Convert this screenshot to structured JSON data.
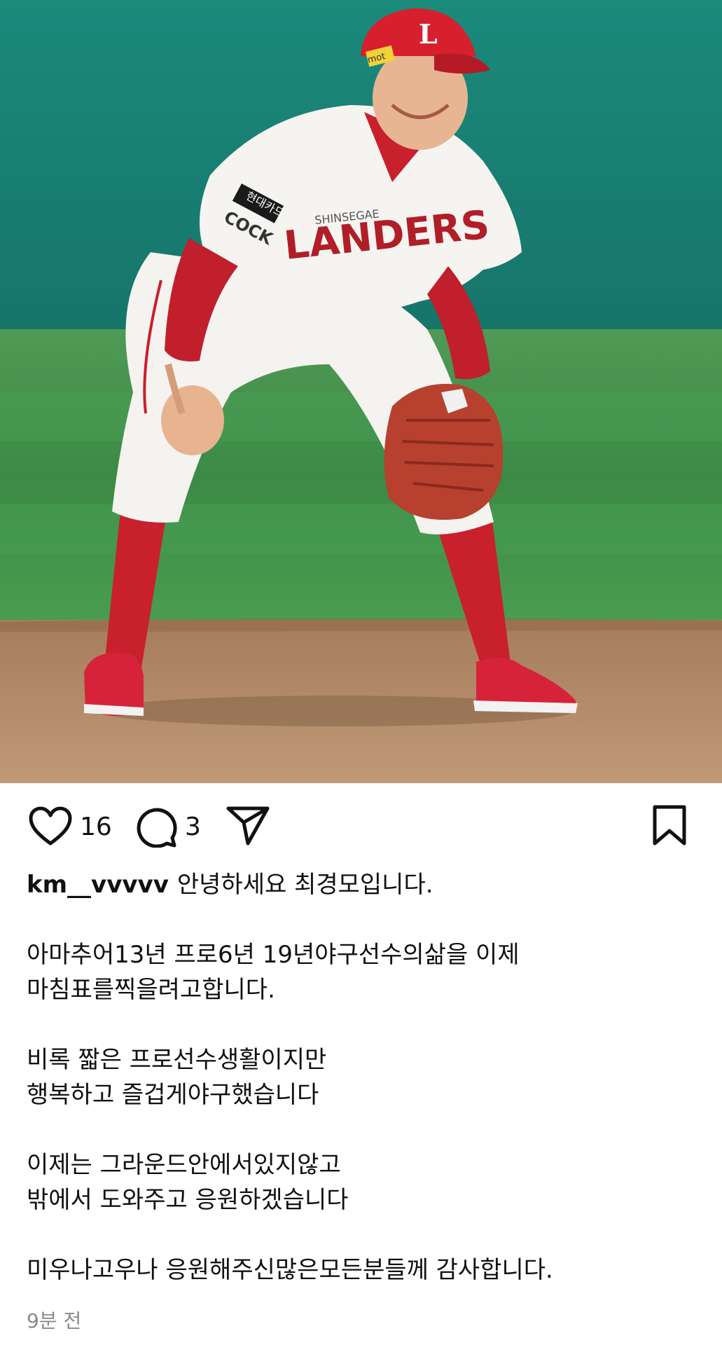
{
  "post": {
    "username": "km__vvvvv",
    "likes": "16",
    "comments": "3",
    "caption": [
      "안녕하세요 최경모입니다.",
      "",
      "아마추어13년 프로6년 19년야구선수의삶을 이제",
      "마침표를찍을려고합니다.",
      "",
      "비록 짧은 프로선수생활이지만",
      "행복하고 즐겁게야구했습니다",
      "",
      "이제는 그라운드안에서있지않고",
      "밖에서 도와주고 응원하겠습니다",
      "",
      "미우나고우나 응원해주신많은모든분들께 감사합니다."
    ],
    "timestamp": "9분 전"
  },
  "photo": {
    "jersey_text": "LANDERS",
    "sponsor_text": "SHINSEGAE",
    "sleeve_text": "COCK",
    "patch_text": "현대카드",
    "cap_letter": "L",
    "cap_badge": "mot"
  },
  "icons": {
    "like": "heart-icon",
    "comment": "comment-bubble-icon",
    "share": "paper-plane-icon",
    "save": "bookmark-icon"
  },
  "colors": {
    "jersey_red": "#c8202c",
    "field_green": "#3e9a4c",
    "wall_teal": "#1c8a7a",
    "dirt": "#b58b6a"
  }
}
